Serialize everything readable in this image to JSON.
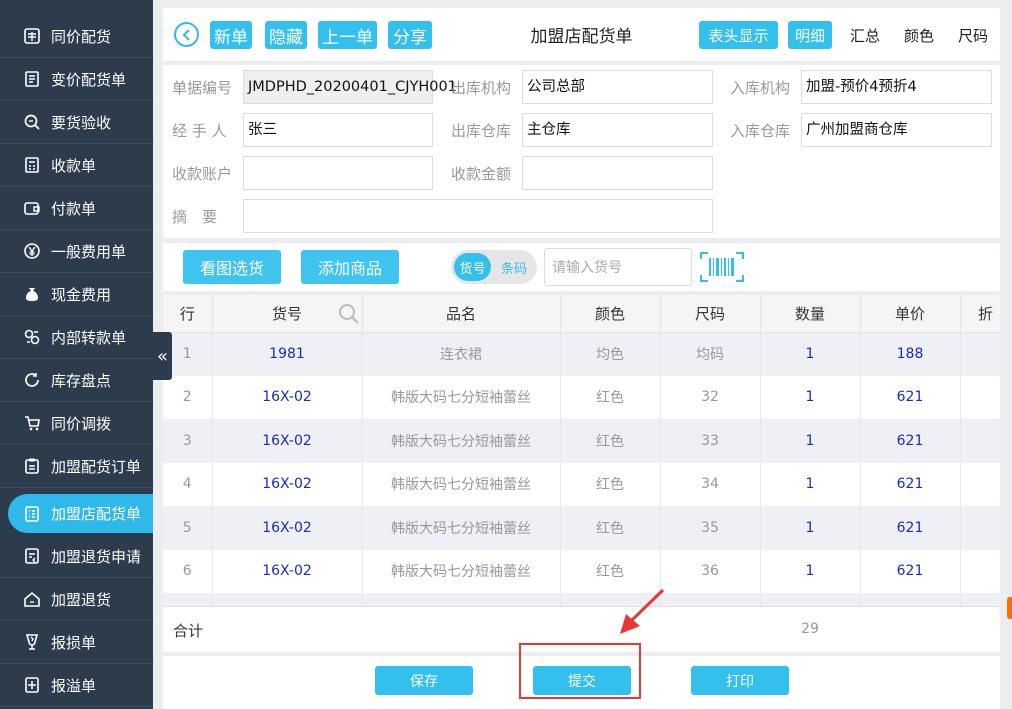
{
  "sidebar": {
    "items": [
      {
        "label": "同价配货",
        "icon": "ledger-icon"
      },
      {
        "label": "变价配货单",
        "icon": "document-icon"
      },
      {
        "label": "要货验收",
        "icon": "magnifier-icon"
      },
      {
        "label": "收款单",
        "icon": "calculator-icon"
      },
      {
        "label": "付款单",
        "icon": "wallet-icon"
      },
      {
        "label": "一般费用单",
        "icon": "yen-circle-icon"
      },
      {
        "label": "现金费用",
        "icon": "money-bag-icon"
      },
      {
        "label": "内部转款单",
        "icon": "transfer-icon"
      },
      {
        "label": "库存盘点",
        "icon": "refresh-icon"
      },
      {
        "label": "同价调拨",
        "icon": "cart-icon"
      },
      {
        "label": "加盟配货订单",
        "icon": "clipboard-icon"
      },
      {
        "label": "加盟店配货单",
        "icon": "list-icon"
      },
      {
        "label": "加盟退货申请",
        "icon": "return-doc-icon"
      },
      {
        "label": "加盟退货",
        "icon": "home-return-icon"
      },
      {
        "label": "报损单",
        "icon": "broken-glass-icon"
      },
      {
        "label": "报溢单",
        "icon": "overflow-icon"
      }
    ],
    "active_index": 11,
    "collapse_glyph": "«"
  },
  "toolbar": {
    "new_label": "新单",
    "hide_label": "隐藏",
    "prev_label": "上一单",
    "share_label": "分享",
    "title": "加盟店配货单",
    "header_display_label": "表头显示",
    "detail_label": "明细",
    "summary_label": "汇总",
    "color_label": "颜色",
    "size_label": "尺码"
  },
  "form": {
    "doc_no_label": "单据编号",
    "doc_no_value": "JMDPHD_20200401_CJYH001",
    "out_org_label": "出库机构",
    "out_org_value": "公司总部",
    "in_org_label": "入库机构",
    "in_org_value": "加盟-预价4预折4",
    "handler_label": "经 手 人",
    "handler_value": "张三",
    "out_wh_label": "出库仓库",
    "out_wh_value": "主仓库",
    "in_wh_label": "入库仓库",
    "in_wh_value": "广州加盟商仓库",
    "account_label": "收款账户",
    "account_value": "",
    "amount_label": "收款金额",
    "amount_value": "",
    "remark_label": "摘　要",
    "remark_value": ""
  },
  "actions": {
    "pick_by_image_label": "看图选货",
    "add_product_label": "添加商品",
    "mode_sku_label": "货号",
    "mode_barcode_label": "条码",
    "sku_placeholder": "请输入货号"
  },
  "grid": {
    "columns": [
      "行",
      "货号",
      "品名",
      "颜色",
      "尺码",
      "数量",
      "单价",
      "折"
    ],
    "rows": [
      {
        "row": "1",
        "sku": "1981",
        "name": "连衣裙",
        "color": "均色",
        "size": "均码",
        "qty": "1",
        "price": "188"
      },
      {
        "row": "2",
        "sku": "16X-02",
        "name": "韩版大码七分短袖蕾丝",
        "color": "红色",
        "size": "32",
        "qty": "1",
        "price": "621"
      },
      {
        "row": "3",
        "sku": "16X-02",
        "name": "韩版大码七分短袖蕾丝",
        "color": "红色",
        "size": "33",
        "qty": "1",
        "price": "621"
      },
      {
        "row": "4",
        "sku": "16X-02",
        "name": "韩版大码七分短袖蕾丝",
        "color": "红色",
        "size": "34",
        "qty": "1",
        "price": "621"
      },
      {
        "row": "5",
        "sku": "16X-02",
        "name": "韩版大码七分短袖蕾丝",
        "color": "红色",
        "size": "35",
        "qty": "1",
        "price": "621"
      },
      {
        "row": "6",
        "sku": "16X-02",
        "name": "韩版大码七分短袖蕾丝",
        "color": "红色",
        "size": "36",
        "qty": "1",
        "price": "621"
      }
    ],
    "total_label": "合计",
    "total_qty": "29"
  },
  "footer": {
    "save_label": "保存",
    "submit_label": "提交",
    "print_label": "打印"
  },
  "colors": {
    "sidebar_bg": "#2d3c4d",
    "accent": "#34c0ed",
    "annotation": "#e53935",
    "grid_blue_text": "#1a2bb8"
  }
}
